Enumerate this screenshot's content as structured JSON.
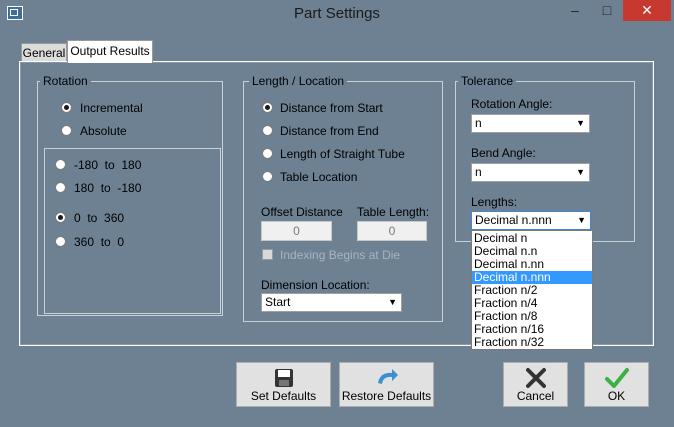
{
  "window": {
    "title": "Part Settings",
    "minimize": "–",
    "maximize": "□",
    "close": "✕"
  },
  "tabs": [
    {
      "label": "General"
    },
    {
      "label": "Output Results"
    }
  ],
  "rotation": {
    "group_label": "Rotation",
    "options": [
      "Incremental",
      "Absolute"
    ],
    "selected": "Incremental",
    "range_options": [
      "-180  to  180",
      "180  to  -180",
      "0  to  360",
      "360  to  0"
    ],
    "range_selected": "0  to  360"
  },
  "length": {
    "group_label": "Length / Location",
    "options": [
      "Distance from Start",
      "Distance from End",
      "Length of Straight Tube",
      "Table Location"
    ],
    "selected": "Distance from Start",
    "offset_label": "Offset Distance",
    "offset_value": "0",
    "table_length_label": "Table Length:",
    "table_length_value": "0",
    "indexing_label": "Indexing Begins at Die",
    "dimension_label": "Dimension Location:",
    "dimension_value": "Start"
  },
  "tolerance": {
    "group_label": "Tolerance",
    "rotation_angle_label": "Rotation Angle:",
    "rotation_angle_value": "n",
    "bend_angle_label": "Bend Angle:",
    "bend_angle_value": "n",
    "lengths_label": "Lengths:",
    "lengths_value": "Decimal n.nnn",
    "lengths_options": [
      "Decimal n",
      "Decimal n.n",
      "Decimal n.nn",
      "Decimal n.nnn",
      "Fraction n/2",
      "Fraction n/4",
      "Fraction n/8",
      "Fraction n/16",
      "Fraction n/32"
    ],
    "lengths_highlighted": "Decimal n.nnn"
  },
  "buttons": {
    "set_defaults": "Set Defaults",
    "restore_defaults": "Restore Defaults",
    "cancel": "Cancel",
    "ok": "OK"
  },
  "colors": {
    "background": "#6d8193",
    "close": "#c7392f",
    "highlight": "#3399ff"
  }
}
